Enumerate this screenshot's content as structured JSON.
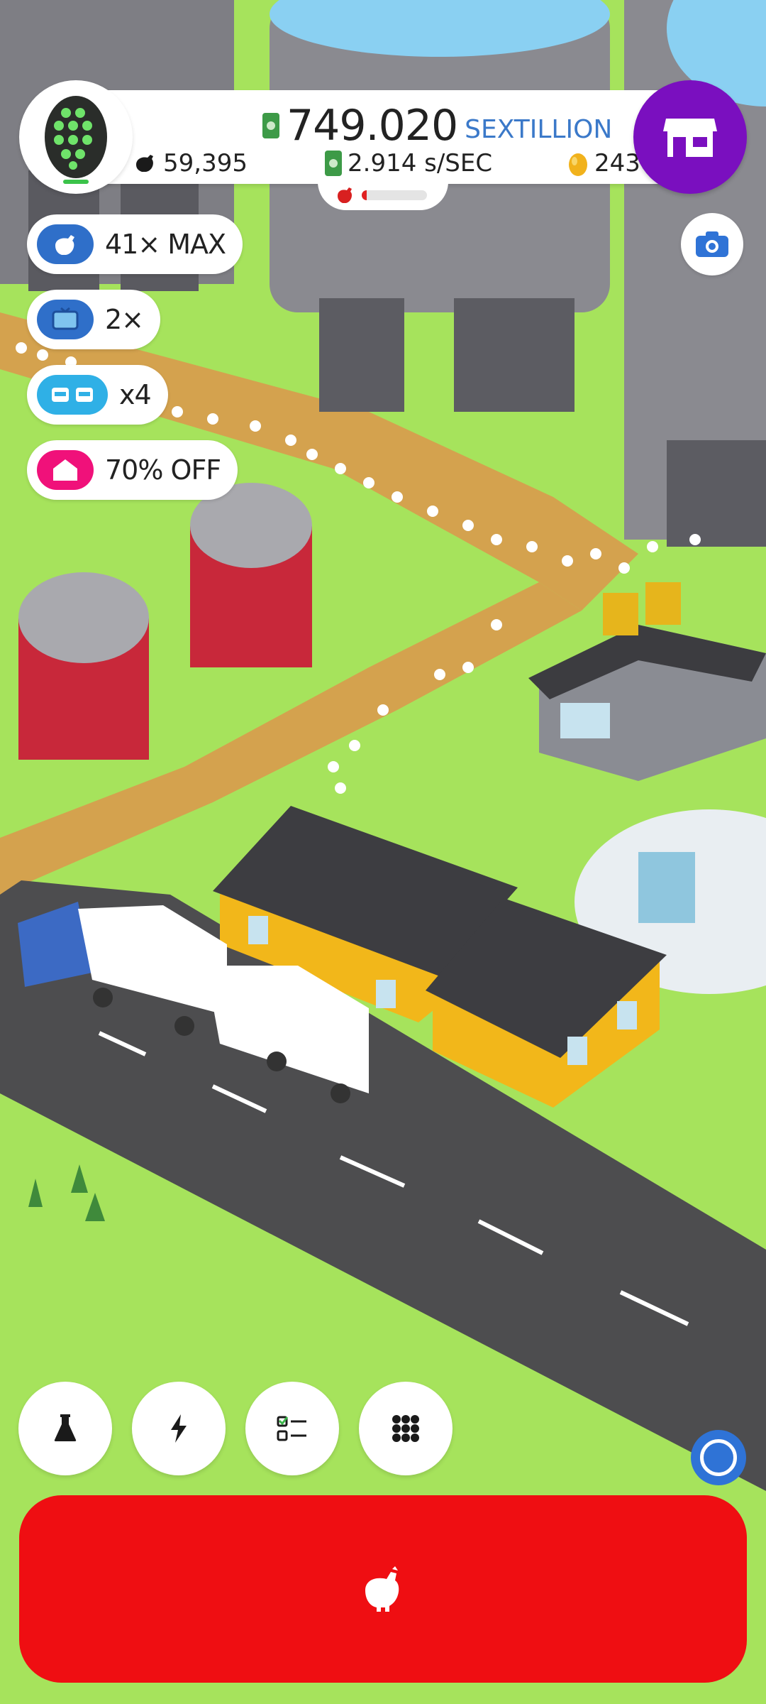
{
  "game": {
    "egg_icon": "green-honeycomb-egg-icon",
    "cash": {
      "amount": "749.020",
      "unit": "SEXTILLION",
      "icon": "cash-icon"
    },
    "chickens": {
      "count": "59,395",
      "icon": "chicken-icon"
    },
    "income_rate": {
      "value": "2.914 s/SEC",
      "icon": "cash-icon"
    },
    "golden_eggs": {
      "count": "243",
      "icon": "golden-egg-icon"
    },
    "hatch_progress": 0.08,
    "shop_icon": "shop-icon",
    "camera_icon": "camera-icon"
  },
  "boosts": [
    {
      "id": "chicken-boost",
      "icon": "chicken-icon",
      "label": "41× MAX",
      "color": "#2f6fc9"
    },
    {
      "id": "video-boost",
      "icon": "tv-icon",
      "label": "2×",
      "color": "#2f6fc9"
    },
    {
      "id": "drone-boost",
      "icon": "drone-icon",
      "label": "x4",
      "color": "#2fb0e6"
    },
    {
      "id": "sale-boost",
      "icon": "house-icon",
      "label": "70% OFF",
      "color": "#f0117a"
    }
  ],
  "toolbar": [
    {
      "id": "research",
      "icon": "flask-icon"
    },
    {
      "id": "boosts",
      "icon": "lightning-icon"
    },
    {
      "id": "missions",
      "icon": "checklist-icon"
    },
    {
      "id": "menu",
      "icon": "grid-icon"
    }
  ],
  "hatch_button": {
    "icon": "chicken-icon",
    "color": "#ef0e12"
  },
  "colors": {
    "grass": "#a6e35c",
    "road": "#4d4d4f",
    "path": "#d4a24e",
    "shop": "#7a0fbf"
  }
}
